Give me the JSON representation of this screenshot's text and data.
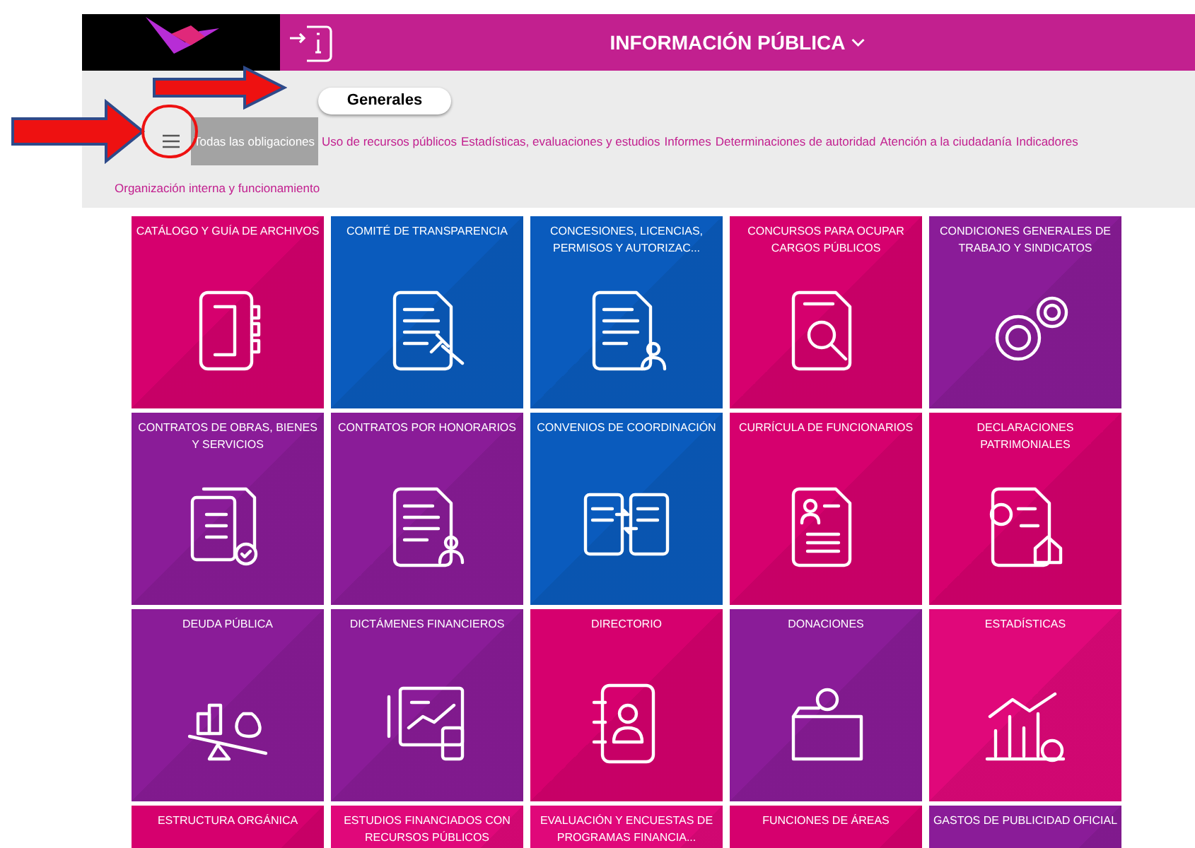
{
  "header": {
    "title": "INFORMACIÓN PÚBLICA"
  },
  "section_tab": {
    "label": "Generales"
  },
  "categories": [
    {
      "label": "Todas las obligaciones",
      "selected": true
    },
    {
      "label": "Uso de recursos públicos",
      "selected": false
    },
    {
      "label": "Estadísticas, evaluaciones y estudios",
      "selected": false
    },
    {
      "label": "Informes",
      "selected": false
    },
    {
      "label": "Determinaciones de autoridad",
      "selected": false
    },
    {
      "label": "Atención a la ciudadanía",
      "selected": false
    },
    {
      "label": "Indicadores",
      "selected": false
    },
    {
      "label": "Organización interna y funcionamiento",
      "selected": false
    }
  ],
  "tiles": [
    {
      "label": "CATÁLOGO Y GUÍA DE ARCHIVOS",
      "color": "#d6006e"
    },
    {
      "label": "COMITÉ DE TRANSPARENCIA",
      "color": "#0a5bbd"
    },
    {
      "label": "CONCESIONES, LICENCIAS, PERMISOS Y AUTORIZAC...",
      "color": "#0a5bbd"
    },
    {
      "label": "CONCURSOS PARA OCUPAR CARGOS PÚBLICOS",
      "color": "#d6006e"
    },
    {
      "label": "CONDICIONES GENERALES DE TRABAJO Y SINDICATOS",
      "color": "#8a1c98"
    },
    {
      "label": "CONTRATOS DE OBRAS, BIENES Y SERVICIOS",
      "color": "#8a1c98"
    },
    {
      "label": "CONTRATOS POR HONORARIOS",
      "color": "#8a1c98"
    },
    {
      "label": "CONVENIOS DE COORDINACIÓN",
      "color": "#0a5bbd"
    },
    {
      "label": "CURRÍCULA DE FUNCIONARIOS",
      "color": "#d6006e"
    },
    {
      "label": "DECLARACIONES PATRIMONIALES",
      "color": "#d6006e"
    },
    {
      "label": "DEUDA PÚBLICA",
      "color": "#8a1c98"
    },
    {
      "label": "DICTÁMENES FINANCIEROS",
      "color": "#8a1c98"
    },
    {
      "label": "DIRECTORIO",
      "color": "#d6006e"
    },
    {
      "label": "DONACIONES",
      "color": "#8a1c98"
    },
    {
      "label": "ESTADÍSTICAS",
      "color": "#e0087a"
    },
    {
      "label": "ESTRUCTURA ORGÁNICA",
      "color": "#d6006e"
    },
    {
      "label": "ESTUDIOS FINANCIADOS CON RECURSOS PÚBLICOS",
      "color": "#e0087a"
    },
    {
      "label": "EVALUACIÓN Y ENCUESTAS DE PROGRAMAS FINANCIA...",
      "color": "#e0087a"
    },
    {
      "label": "FUNCIONES DE ÁREAS",
      "color": "#d6006e"
    },
    {
      "label": "GASTOS DE PUBLICIDAD OFICIAL",
      "color": "#8a1c98"
    }
  ]
}
